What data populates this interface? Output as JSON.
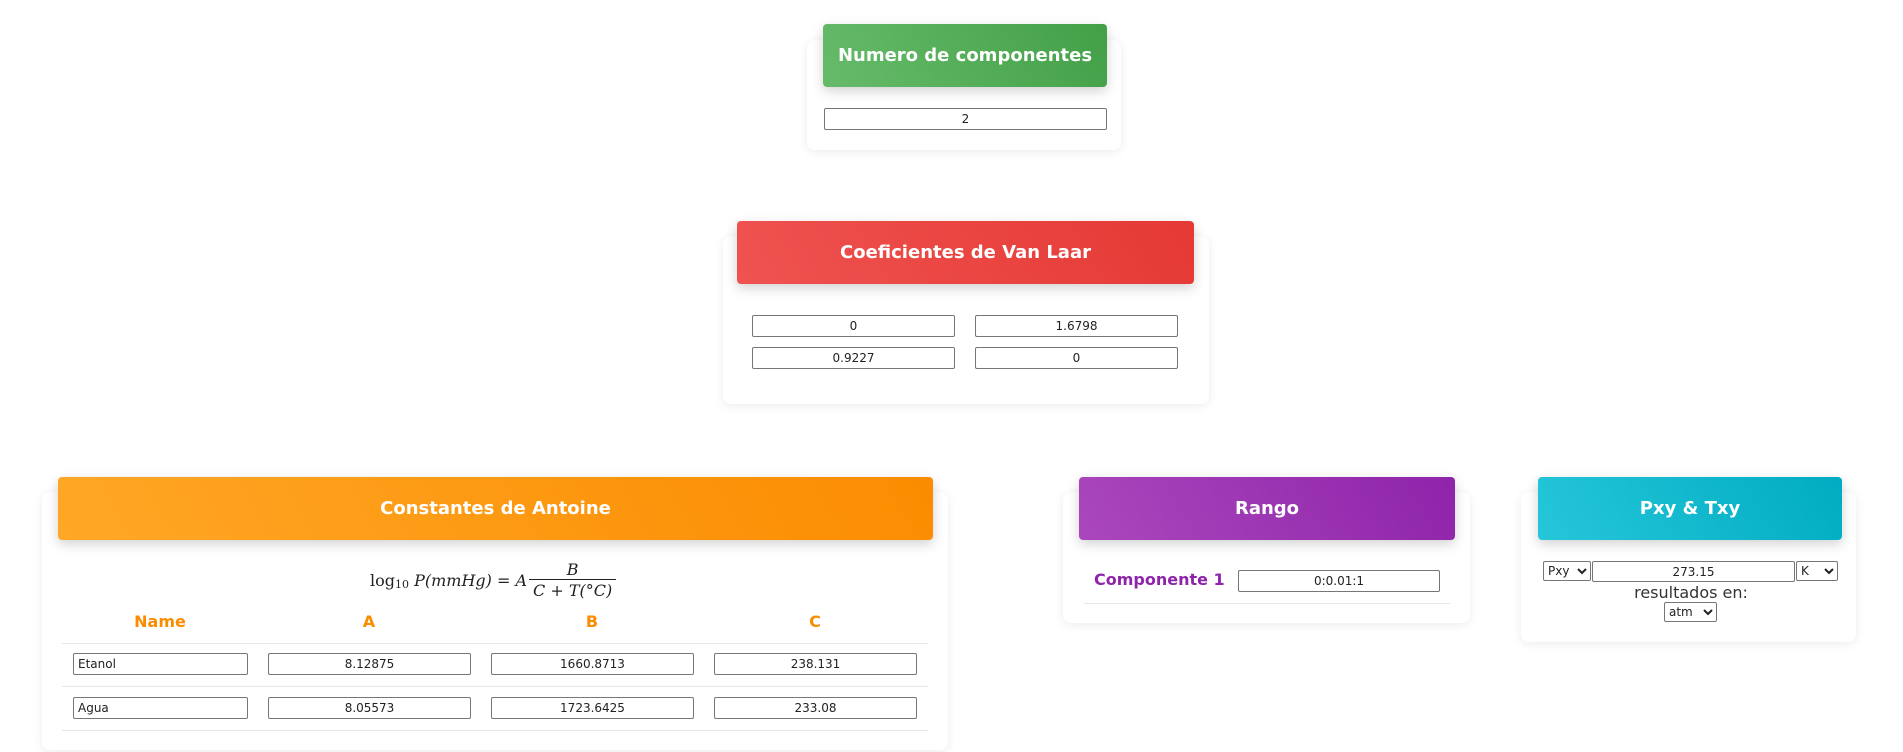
{
  "componentes": {
    "title": "Numero de componentes",
    "value": "2"
  },
  "van_laar": {
    "title": "Coeficientes de Van Laar",
    "matrix": [
      [
        "0",
        "1.6798"
      ],
      [
        "0.9227",
        "0"
      ]
    ]
  },
  "antoine": {
    "title": "Constantes de Antoine",
    "formula": {
      "lhs": "log",
      "sub": "10",
      "lhs_rest": " P(mmHg) = A",
      "numerator": "B",
      "denominator": "C + T(°C)"
    },
    "headers": [
      "Name",
      "A",
      "B",
      "C"
    ],
    "rows": [
      {
        "name": "Etanol",
        "a": "8.12875",
        "b": "1660.8713",
        "c": "238.131"
      },
      {
        "name": "Agua",
        "a": "8.05573",
        "b": "1723.6425",
        "c": "233.08"
      }
    ]
  },
  "rango": {
    "title": "Rango",
    "label": "Componente 1",
    "value": "0:0.01:1"
  },
  "pxy": {
    "title": "Pxy & Txy",
    "mode_selected": "Pxy",
    "value": "273.15",
    "unit_selected": "K",
    "results_label": "resultados en:",
    "result_unit_selected": "atm"
  },
  "colors": {
    "green": "#43a047",
    "red": "#e53935",
    "orange": "#fb8c00",
    "purple": "#8e24aa",
    "cyan": "#00acc1"
  }
}
